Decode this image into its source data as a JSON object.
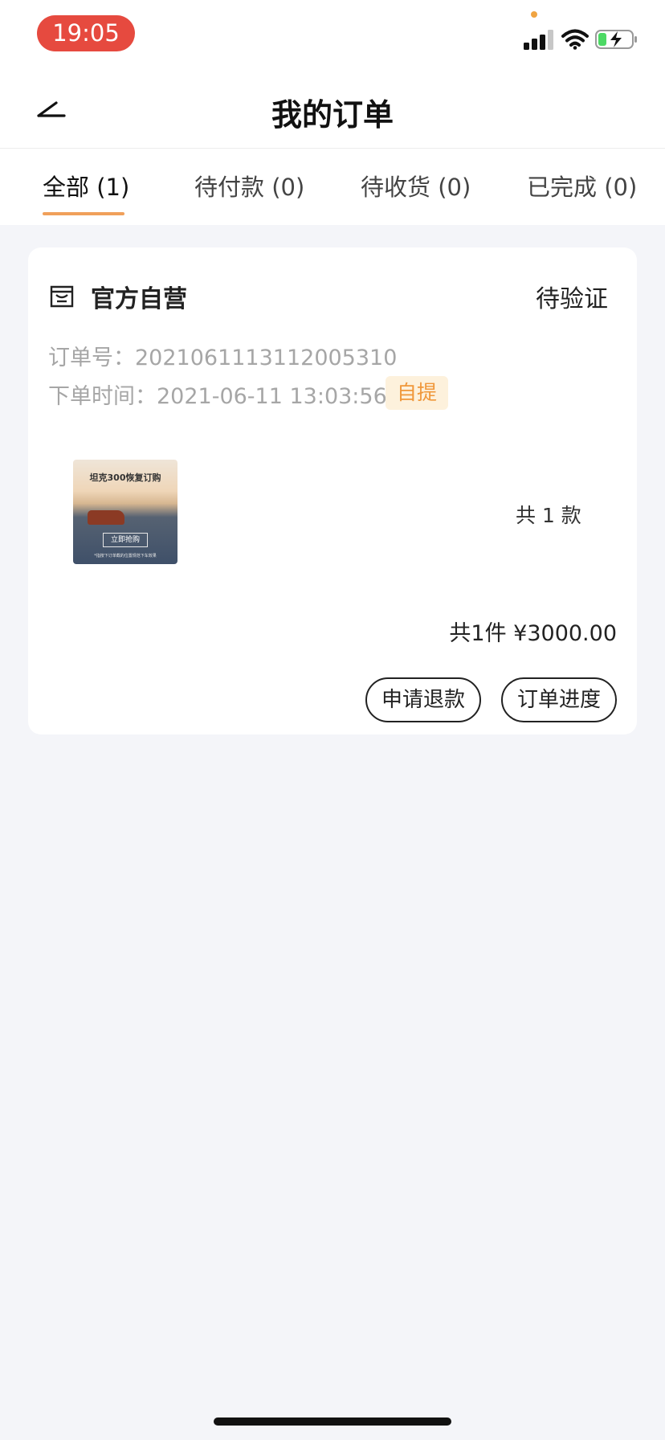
{
  "status_bar": {
    "time": "19:05"
  },
  "header": {
    "title": "我的订单"
  },
  "tabs": [
    {
      "label": "全部 (1)",
      "active": true
    },
    {
      "label": "待付款 (0)",
      "active": false
    },
    {
      "label": "待收货 (0)",
      "active": false
    },
    {
      "label": "已完成 (0)",
      "active": false
    }
  ],
  "order": {
    "store_name": "官方自营",
    "status": "待验证",
    "order_no_label": "订单号：",
    "order_no": "2021061113112005310",
    "time_label": "下单时间：",
    "time": "2021-06-11 13:03:56",
    "pickup_badge": "自提",
    "product_image": {
      "title": "坦克300恢复订购",
      "button_text": "立即抢购",
      "note": "*指按下订单截的位置规范下车效果"
    },
    "kinds_text": "共 1 款",
    "total_text": "共1件 ¥3000.00",
    "actions": {
      "refund": "申请退款",
      "progress": "订单进度"
    }
  },
  "colors": {
    "accent": "#f0a05a",
    "badge_text": "#f0973a",
    "badge_bg": "#fdf1dc",
    "time_pill": "#e64a3f",
    "page_bg": "#f4f5f9"
  },
  "icons": [
    "back-arrow-icon",
    "store-icon",
    "signal-icon",
    "wifi-icon",
    "battery-charging-icon"
  ]
}
